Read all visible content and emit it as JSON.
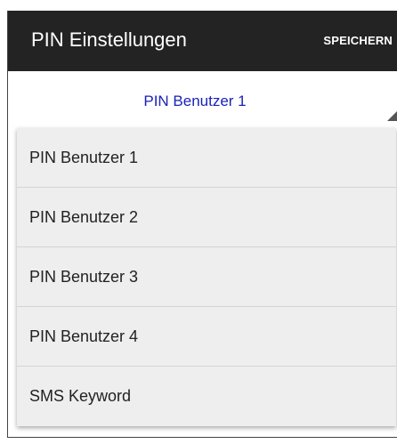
{
  "toolbar": {
    "title": "PIN Einstellungen",
    "save_label": "SPEICHERN",
    "background": "#232323"
  },
  "spinner": {
    "selected": "PIN Benutzer 1",
    "value_color": "#1a22b8"
  },
  "dropdown": {
    "items": [
      {
        "label": "PIN Benutzer 1"
      },
      {
        "label": "PIN Benutzer 2"
      },
      {
        "label": "PIN Benutzer 3"
      },
      {
        "label": "PIN Benutzer 4"
      },
      {
        "label": "SMS Keyword"
      }
    ]
  }
}
